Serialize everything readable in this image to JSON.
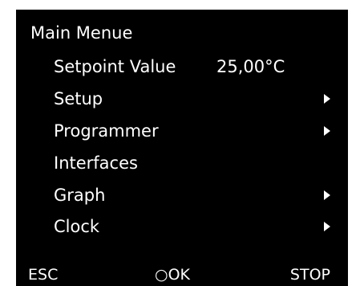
{
  "menu": {
    "title": "Main Menue",
    "items": [
      {
        "label": "Setpoint Value",
        "value": "25,00°C",
        "has_submenu": false
      },
      {
        "label": "Setup",
        "has_submenu": true
      },
      {
        "label": "Programmer",
        "has_submenu": true
      },
      {
        "label": "Interfaces",
        "has_submenu": false
      },
      {
        "label": "Graph",
        "has_submenu": true
      },
      {
        "label": "Clock",
        "has_submenu": true
      }
    ]
  },
  "softkeys": {
    "esc": "ESC",
    "ok": "○OK",
    "stop": "STOP"
  },
  "colors": {
    "screen_background": "#000000",
    "text": "#ffffff"
  },
  "icons": {
    "submenu": "triangle-right-icon"
  }
}
